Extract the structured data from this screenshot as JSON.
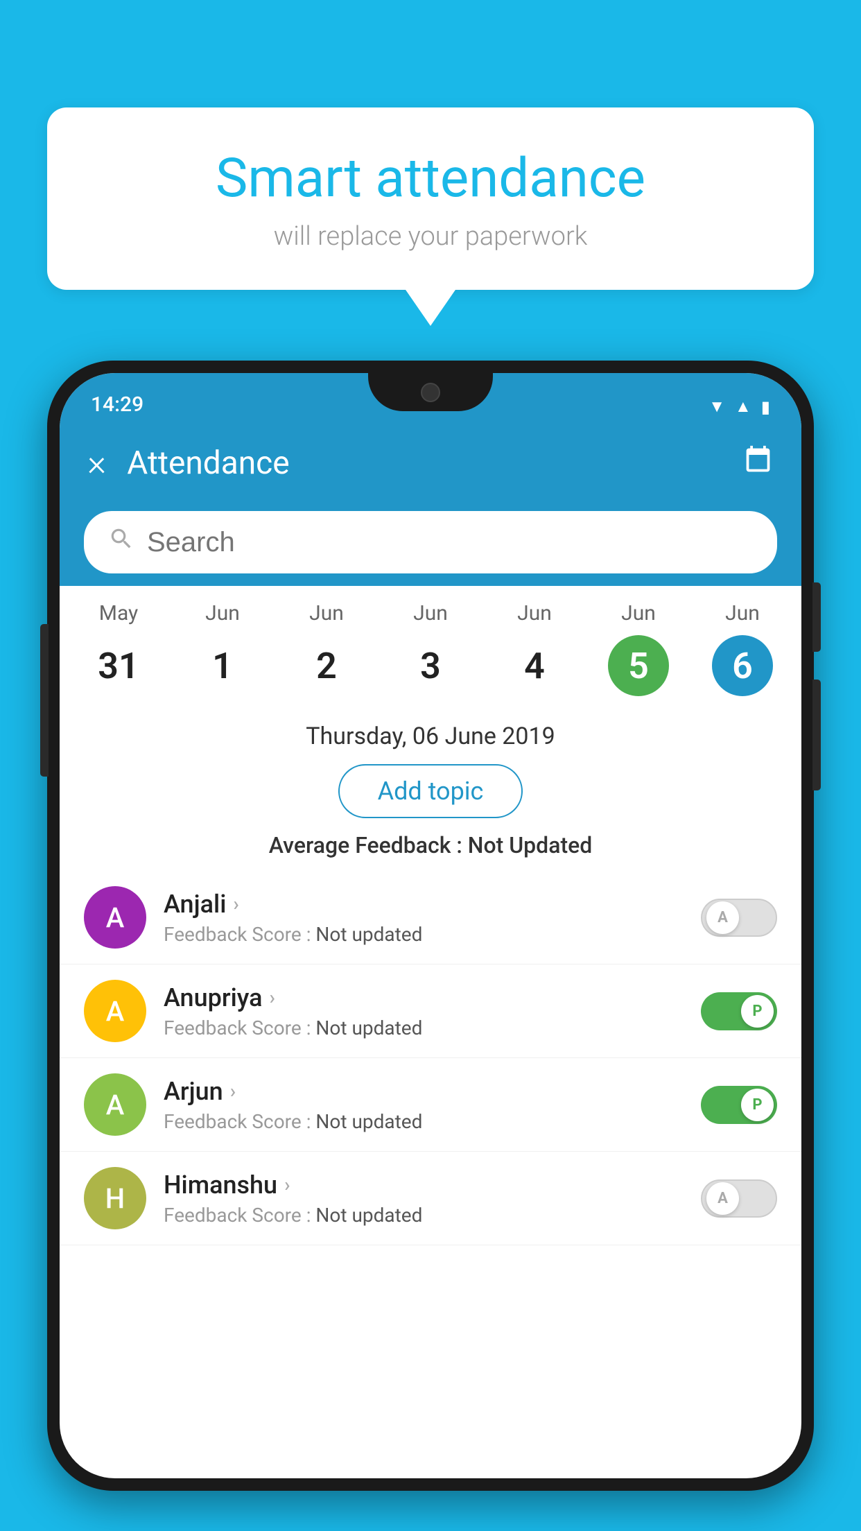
{
  "background_color": "#1ab8e8",
  "speech_bubble": {
    "title": "Smart attendance",
    "subtitle": "will replace your paperwork"
  },
  "status_bar": {
    "time": "14:29",
    "icons": [
      "wifi",
      "signal",
      "battery"
    ]
  },
  "toolbar": {
    "close_label": "×",
    "title": "Attendance",
    "calendar_icon": "📅"
  },
  "search": {
    "placeholder": "Search"
  },
  "calendar": {
    "days": [
      {
        "month": "May",
        "date": "31",
        "style": "normal"
      },
      {
        "month": "Jun",
        "date": "1",
        "style": "normal"
      },
      {
        "month": "Jun",
        "date": "2",
        "style": "normal"
      },
      {
        "month": "Jun",
        "date": "3",
        "style": "normal"
      },
      {
        "month": "Jun",
        "date": "4",
        "style": "normal"
      },
      {
        "month": "Jun",
        "date": "5",
        "style": "today"
      },
      {
        "month": "Jun",
        "date": "6",
        "style": "selected"
      }
    ]
  },
  "selected_date": "Thursday, 06 June 2019",
  "add_topic_label": "Add topic",
  "avg_feedback_label": "Average Feedback :",
  "avg_feedback_value": "Not Updated",
  "students": [
    {
      "name": "Anjali",
      "avatar_letter": "A",
      "avatar_color": "#9c27b0",
      "feedback_label": "Feedback Score :",
      "feedback_value": "Not updated",
      "toggle": "off",
      "toggle_letter": "A"
    },
    {
      "name": "Anupriya",
      "avatar_letter": "A",
      "avatar_color": "#ffc107",
      "feedback_label": "Feedback Score :",
      "feedback_value": "Not updated",
      "toggle": "on",
      "toggle_letter": "P"
    },
    {
      "name": "Arjun",
      "avatar_letter": "A",
      "avatar_color": "#8bc34a",
      "feedback_label": "Feedback Score :",
      "feedback_value": "Not updated",
      "toggle": "on",
      "toggle_letter": "P"
    },
    {
      "name": "Himanshu",
      "avatar_letter": "H",
      "avatar_color": "#adb548",
      "feedback_label": "Feedback Score :",
      "feedback_value": "Not updated",
      "toggle": "off",
      "toggle_letter": "A"
    }
  ]
}
